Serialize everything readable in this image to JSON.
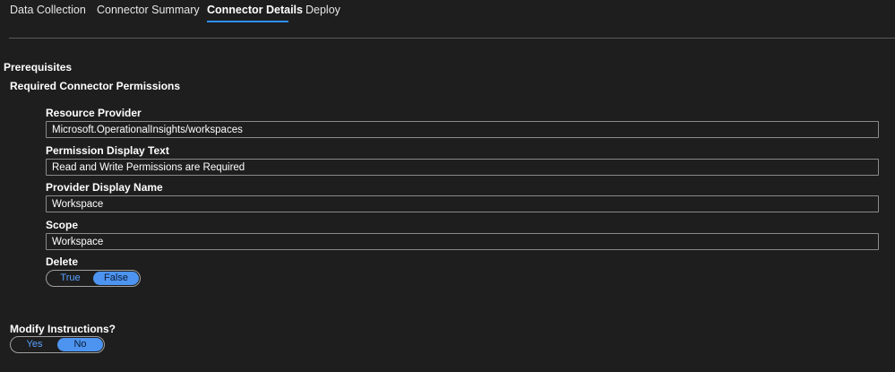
{
  "tabs": [
    {
      "label": "Data Collection"
    },
    {
      "label": "Connector Summary"
    },
    {
      "label": "Connector Details"
    },
    {
      "label": "Deploy"
    }
  ],
  "prerequisites": {
    "title": "Prerequisites",
    "subtitle": "Required Connector Permissions"
  },
  "fields": {
    "resource_provider": {
      "label": "Resource Provider",
      "value": "Microsoft.OperationalInsights/workspaces"
    },
    "permission_display_text": {
      "label": "Permission Display Text",
      "value": "Read and Write Permissions are Required"
    },
    "provider_display_name": {
      "label": "Provider Display Name",
      "value": "Workspace"
    },
    "scope": {
      "label": "Scope",
      "value": "Workspace"
    }
  },
  "delete": {
    "label": "Delete",
    "options": [
      "True",
      "False"
    ],
    "selected": "False"
  },
  "modify": {
    "label": "Modify Instructions?",
    "options": [
      "Yes",
      "No"
    ],
    "selected": "No"
  },
  "colors": {
    "accent": "#2f8fff",
    "toggle_selected": "#4d94f0",
    "background": "#1e1e1e"
  }
}
